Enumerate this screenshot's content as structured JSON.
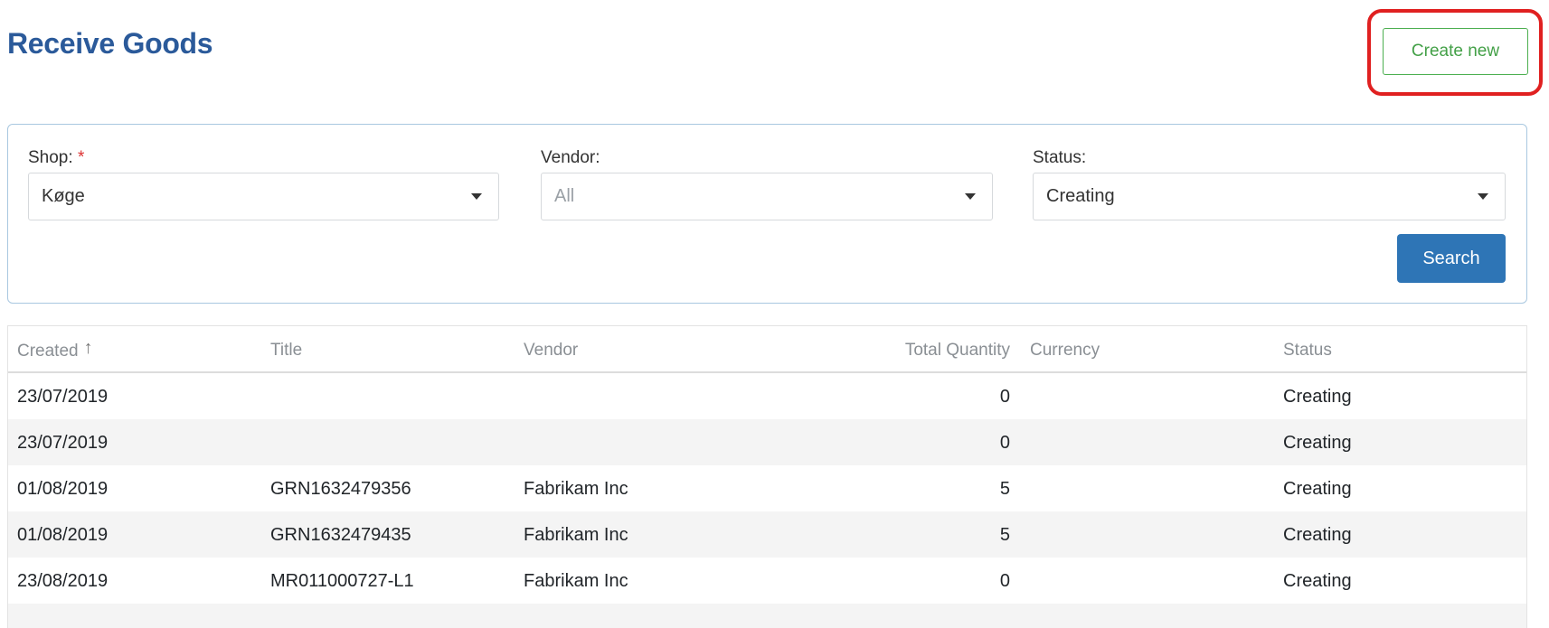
{
  "page": {
    "title": "Receive Goods",
    "create_label": "Create new"
  },
  "filters": {
    "shop": {
      "label": "Shop:",
      "required_mark": "*",
      "value": "Køge"
    },
    "vendor": {
      "label": "Vendor:",
      "placeholder": "All"
    },
    "status": {
      "label": "Status:",
      "value": "Creating"
    },
    "search_label": "Search"
  },
  "table": {
    "columns": [
      "Created",
      "Title",
      "Vendor",
      "Total Quantity",
      "Currency",
      "Status"
    ],
    "sort_indicator": "↑",
    "rows": [
      {
        "created": "23/07/2019",
        "title": "",
        "vendor": "",
        "qty": "0",
        "currency": "",
        "status": "Creating"
      },
      {
        "created": "23/07/2019",
        "title": "",
        "vendor": "",
        "qty": "0",
        "currency": "",
        "status": "Creating"
      },
      {
        "created": "01/08/2019",
        "title": "GRN1632479356",
        "vendor": "Fabrikam Inc",
        "qty": "5",
        "currency": "",
        "status": "Creating"
      },
      {
        "created": "01/08/2019",
        "title": "GRN1632479435",
        "vendor": "Fabrikam Inc",
        "qty": "5",
        "currency": "",
        "status": "Creating"
      },
      {
        "created": "23/08/2019",
        "title": "MR011000727-L1",
        "vendor": "Fabrikam Inc",
        "qty": "0",
        "currency": "",
        "status": "Creating"
      },
      {
        "created": "",
        "title": "",
        "vendor": "",
        "qty": "",
        "currency": "",
        "status": ""
      }
    ]
  },
  "colors": {
    "title": "#2b5a9a",
    "create_button": "#43a047",
    "highlight": "#e02020",
    "search_button": "#2e75b6"
  }
}
